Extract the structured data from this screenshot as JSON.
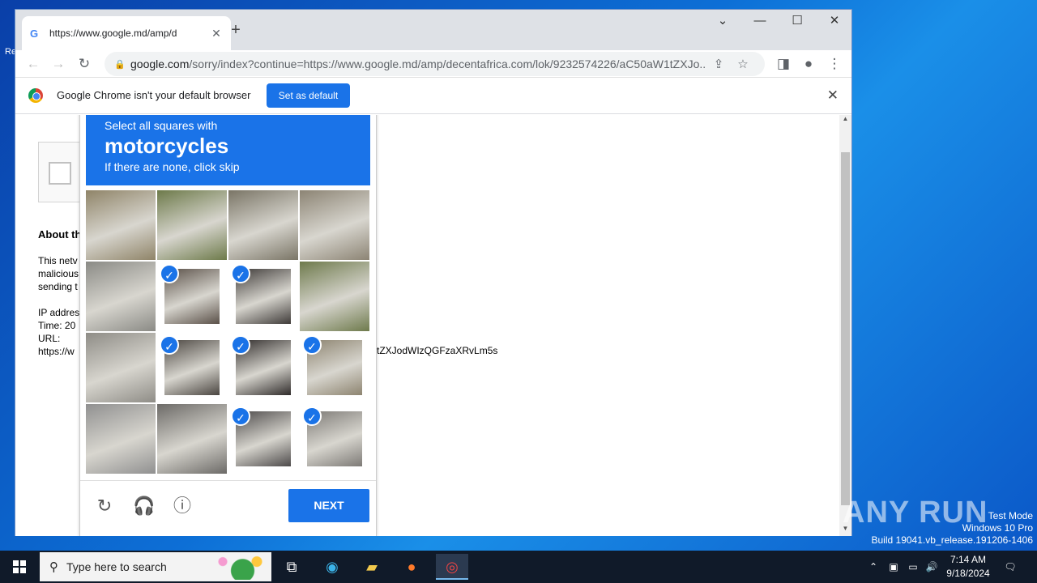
{
  "browser": {
    "tab_title": "https://www.google.md/amp/d",
    "tab_icon": "G",
    "new_tab": "+",
    "url_host": "google.com",
    "url_rest": "/sorry/index?continue=https://www.google.md/amp/decentafrica.com/lok/9232574226/aC50aW1tZXJo...",
    "window_controls": [
      "⌄",
      "—",
      "☐",
      "✕"
    ]
  },
  "infobar": {
    "message": "Google Chrome isn't your default browser",
    "button": "Set as default"
  },
  "page": {
    "about_heading": "About th",
    "about_lines": [
      "This netv",
      "malicious",
      "sending t",
      "",
      "IP addres",
      "Time: 20",
      "URL:",
      "https://w"
    ],
    "url_tail": "tZXJodWIzQGFzaXRvLm5s"
  },
  "captcha": {
    "instruction": "Select all squares with",
    "target": "motorcycles",
    "hint": "If there are none, click skip",
    "next_label": "NEXT",
    "selected_tiles": [
      5,
      6,
      9,
      10,
      11,
      14,
      15
    ],
    "tile_colors": [
      "#8f8468",
      "#6d7a4a",
      "#7a7566",
      "#8c8474",
      "#8a8a85",
      "#5a5048",
      "#3e3a38",
      "#6e7a4c",
      "#8e8c86",
      "#4a4540",
      "#2f2b2a",
      "#8d8470",
      "#909090",
      "#6c6a67",
      "#4d4a4a",
      "#7d7a76"
    ]
  },
  "taskbar": {
    "search_placeholder": "Type here to search",
    "time": "7:14 AM",
    "date": "9/18/2024"
  },
  "watermark": {
    "brand": "ANY RUN",
    "line1": "Test Mode",
    "line2": "Windows 10 Pro",
    "line3": "Build 19041.vb_release.191206-1406"
  }
}
